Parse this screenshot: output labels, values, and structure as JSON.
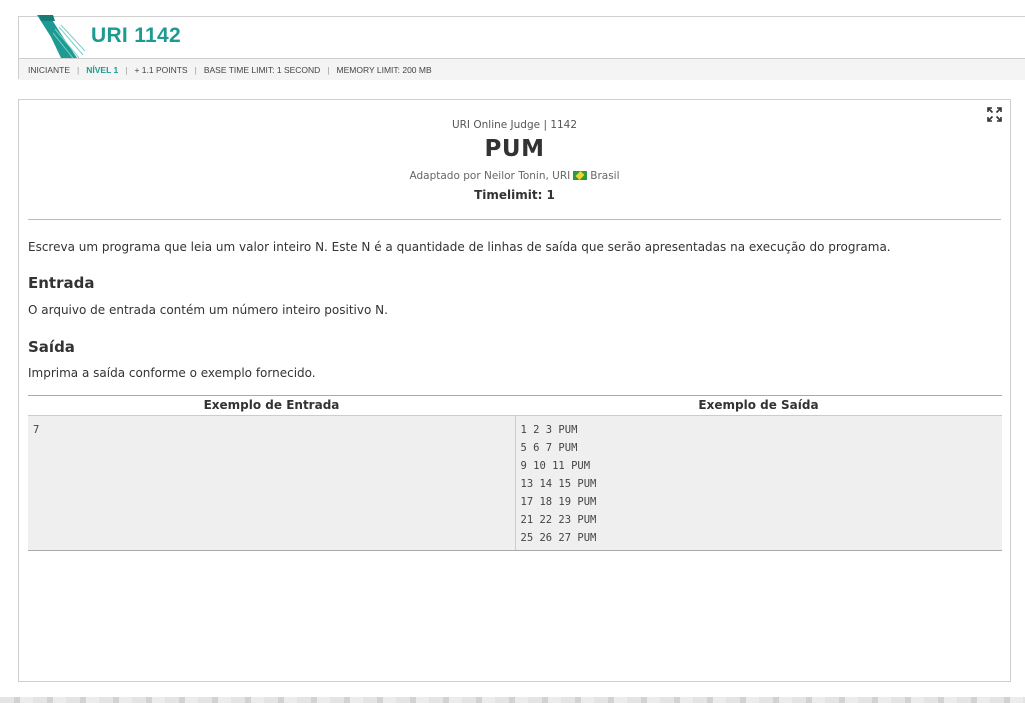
{
  "header": {
    "problem_code": "URI 1142",
    "meta": {
      "category": "INICIANTE",
      "level": "NÍVEL 1",
      "points": "+ 1.1 POINTS",
      "base_time": "BASE TIME LIMIT: 1 SECOND",
      "memory": "MEMORY LIMIT: 200 MB"
    },
    "accent_color": "#1d9b92"
  },
  "problem": {
    "judge": "URI Online Judge | 1142",
    "title": "PUM",
    "author_prefix": "Adaptado por Neilor Tonin, URI",
    "author_country": "Brasil",
    "timelimit": "Timelimit: 1",
    "description": "Escreva um programa que leia um valor inteiro N. Este N é a quantidade de linhas de saída que serão apresentadas na execução do programa.",
    "input_heading": "Entrada",
    "input_text": "O arquivo de entrada contém um número inteiro positivo N.",
    "output_heading": "Saída",
    "output_text": "Imprima a saída conforme o exemplo fornecido."
  },
  "examples": {
    "input_header": "Exemplo de Entrada",
    "output_header": "Exemplo de Saída",
    "input_lines": [
      "7"
    ],
    "output_lines": [
      "1 2 3 PUM",
      "5 6 7 PUM",
      "9 10 11 PUM",
      "13 14 15 PUM",
      "17 18 19 PUM",
      "21 22 23 PUM",
      "25 26 27 PUM"
    ]
  },
  "icons": {
    "expand": "expand-icon",
    "flag": "brazil-flag-icon",
    "logo": "uri-logo-icon"
  }
}
